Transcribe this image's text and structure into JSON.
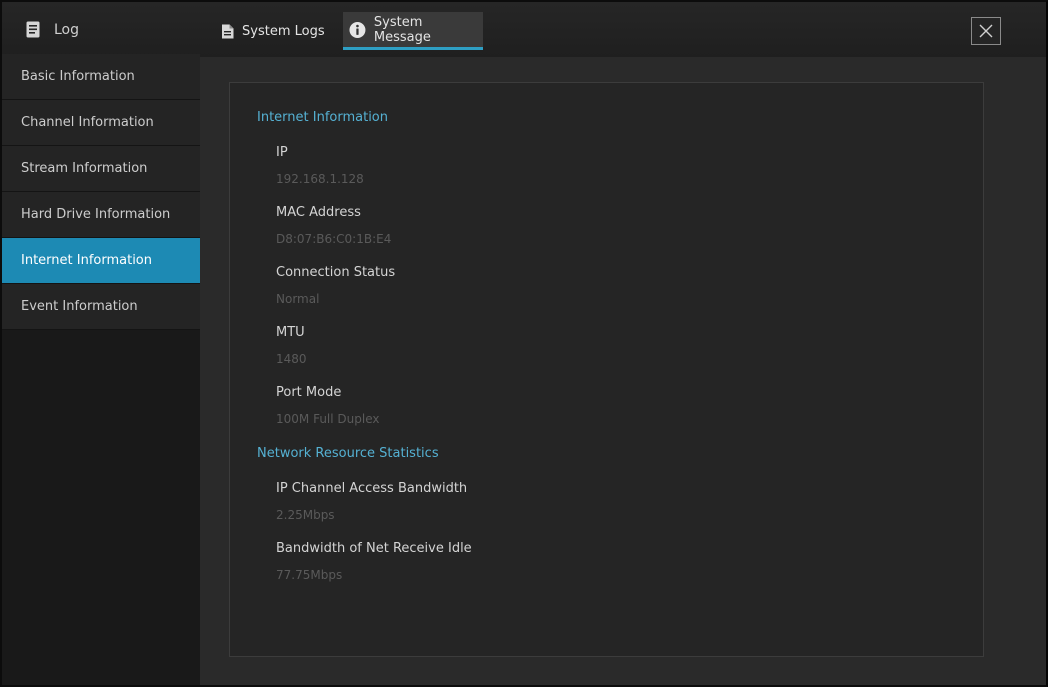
{
  "window": {
    "title": "Log",
    "close_icon": "close-icon"
  },
  "tabs": [
    {
      "label": "System Logs",
      "icon": "document-icon",
      "active": false
    },
    {
      "label": "System Message",
      "icon": "info-icon",
      "active": true
    }
  ],
  "sidebar": {
    "items": [
      {
        "label": "Basic Information",
        "active": false
      },
      {
        "label": "Channel Information",
        "active": false
      },
      {
        "label": "Stream Information",
        "active": false
      },
      {
        "label": "Hard Drive Information",
        "active": false
      },
      {
        "label": "Internet Information",
        "active": true
      },
      {
        "label": "Event Information",
        "active": false
      }
    ]
  },
  "main": {
    "internet": {
      "title": "Internet Information",
      "fields": [
        {
          "label": "IP",
          "value": "192.168.1.128"
        },
        {
          "label": "MAC Address",
          "value": "D8:07:B6:C0:1B:E4"
        },
        {
          "label": "Connection Status",
          "value": "Normal"
        },
        {
          "label": "MTU",
          "value": "1480"
        },
        {
          "label": "Port Mode",
          "value": "100M Full Duplex"
        }
      ]
    },
    "network": {
      "title": "Network Resource Statistics",
      "fields": [
        {
          "label": "IP Channel Access Bandwidth",
          "value": "2.25Mbps"
        },
        {
          "label": "Bandwidth of Net Receive Idle",
          "value": "77.75Mbps"
        }
      ]
    }
  },
  "colors": {
    "accent": "#1d8ab4",
    "section_title": "#55b1d3",
    "tab_underline": "#2e9fc4"
  }
}
